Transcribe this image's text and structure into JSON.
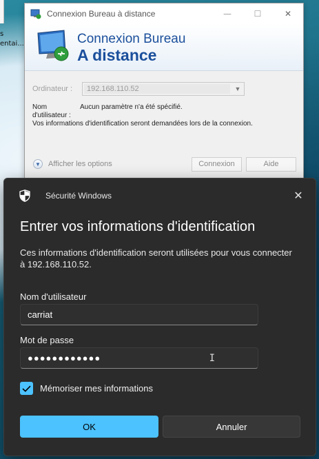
{
  "desktop": {
    "icon_label_line1": "s",
    "icon_label_line2": "entai..."
  },
  "rdp_window": {
    "title": "Connexion Bureau à distance",
    "minimize_glyph": "—",
    "maximize_glyph": "☐",
    "close_glyph": "✕",
    "header_line1": "Connexion Bureau",
    "header_line2": "A distance",
    "computer_label": "Ordinateur :",
    "computer_value": "192.168.110.52",
    "username_label_line1": "Nom",
    "username_label_line2": "d'utilisateur :",
    "username_value": "Aucun paramètre n'a été spécifié.",
    "info_text": "Vos informations d'identification seront demandées lors de la connexion.",
    "show_options_label": "Afficher les options",
    "connect_button": "Connexion",
    "help_button": "Aide"
  },
  "security_dialog": {
    "app_name": "Sécurité Windows",
    "close_glyph": "✕",
    "title": "Entrer vos informations d'identification",
    "description": "Ces informations d'identification seront utilisées pour vous connecter à 192.168.110.52.",
    "username_label": "Nom d'utilisateur",
    "username_value": "carriat",
    "password_label": "Mot de passe",
    "password_value": "●●●●●●●●●●●●",
    "caret_glyph": "I",
    "remember_label": "Mémoriser mes informations",
    "remember_checked": true,
    "ok_button": "OK",
    "cancel_button": "Annuler"
  },
  "colors": {
    "accent": "#4cc2ff",
    "dialog_bg": "#2b2b2b",
    "rdp_header_text": "#1b4f9c"
  }
}
